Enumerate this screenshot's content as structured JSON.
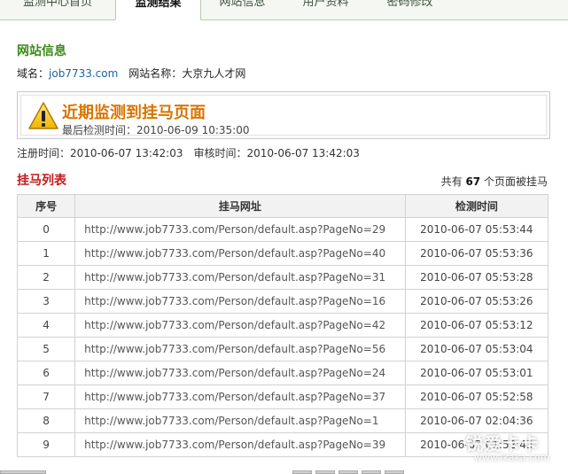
{
  "tabs": [
    {
      "label": "监测中心首页",
      "active": false
    },
    {
      "label": "监测结果",
      "active": true
    },
    {
      "label": "网站信息",
      "active": false
    },
    {
      "label": "用户资料",
      "active": false
    },
    {
      "label": "密码修改",
      "active": false
    }
  ],
  "site_info": {
    "title": "网站信息",
    "domain_label": "域名：",
    "domain_value": "job7733.com",
    "name_label": "网站名称：",
    "name_value": "大京九人才网"
  },
  "alert": {
    "title": "近期监测到挂马页面",
    "last_check_label": "最后检测时间：",
    "last_check_value": "2010-06-09 10:35:00",
    "icon": "warning-icon"
  },
  "registration": {
    "reg_label": "注册时间：",
    "reg_value": "2010-06-07 13:42:03",
    "audit_label": "审核时间：",
    "audit_value": "2010-06-07 13:42:03"
  },
  "list": {
    "title": "挂马列表",
    "total_prefix": "共有",
    "total_count": "67",
    "total_suffix": "个页面被挂马",
    "headers": {
      "index": "序号",
      "url": "挂马网址",
      "time": "检测时间"
    },
    "rows": [
      {
        "index": "0",
        "url": "http://www.job7733.com/Person/default.asp?PageNo=29",
        "time": "2010-06-07 05:53:44"
      },
      {
        "index": "1",
        "url": "http://www.job7733.com/Person/default.asp?PageNo=40",
        "time": "2010-06-07 05:53:36"
      },
      {
        "index": "2",
        "url": "http://www.job7733.com/Person/default.asp?PageNo=31",
        "time": "2010-06-07 05:53:28"
      },
      {
        "index": "3",
        "url": "http://www.job7733.com/Person/default.asp?PageNo=16",
        "time": "2010-06-07 05:53:26"
      },
      {
        "index": "4",
        "url": "http://www.job7733.com/Person/default.asp?PageNo=42",
        "time": "2010-06-07 05:53:12"
      },
      {
        "index": "5",
        "url": "http://www.job7733.com/Person/default.asp?PageNo=56",
        "time": "2010-06-07 05:53:04"
      },
      {
        "index": "6",
        "url": "http://www.job7733.com/Person/default.asp?PageNo=24",
        "time": "2010-06-07 05:53:01"
      },
      {
        "index": "7",
        "url": "http://www.job7733.com/Person/default.asp?PageNo=37",
        "time": "2010-06-07 05:52:58"
      },
      {
        "index": "8",
        "url": "http://www.job7733.com/Person/default.asp?PageNo=1",
        "time": "2010-06-07 02:04:36"
      },
      {
        "index": "9",
        "url": "http://www.job7733.com/Person/default.asp?PageNo=39",
        "time": "2010-06-07 01:52:43"
      }
    ]
  },
  "watermark": {
    "big": "锐爱卡卡",
    "small": "www.ikaka.com"
  },
  "colors": {
    "green_title": "#3a8a1a",
    "red_title": "#c41a1a",
    "alert_orange": "#d97400",
    "link_blue": "#1b62a8"
  }
}
